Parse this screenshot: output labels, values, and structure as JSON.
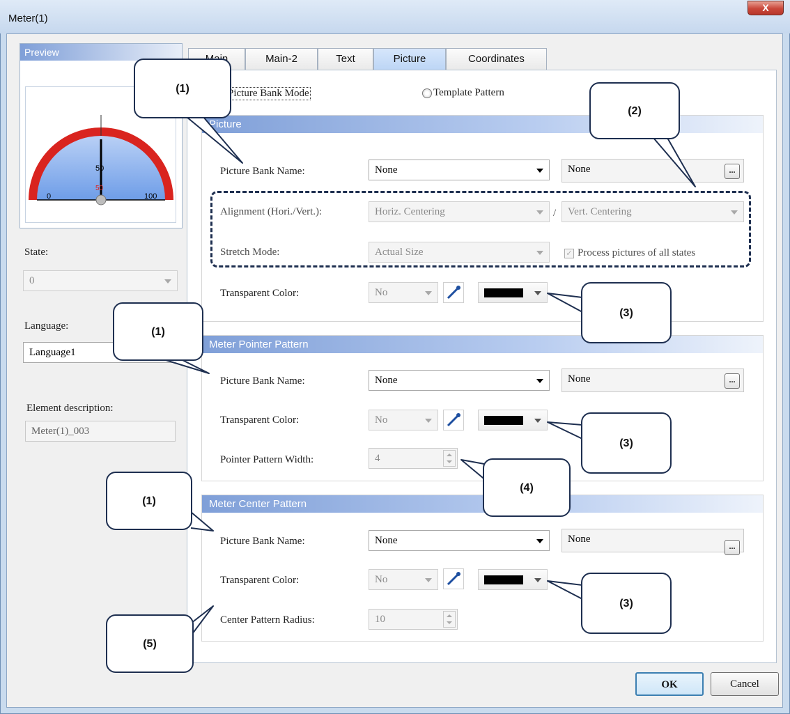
{
  "window": {
    "title": "Meter(1)",
    "close_glyph": "X"
  },
  "preview": {
    "header": "Preview",
    "gauge": {
      "label_top": "50",
      "label_red": "50",
      "label_min": "0",
      "label_max": "100"
    }
  },
  "left": {
    "state_label": "State:",
    "state_value": "0",
    "language_label": "Language:",
    "language_value": "Language1",
    "element_desc_label": "Element description:",
    "element_desc_value": "Meter(1)_003"
  },
  "tabs": [
    {
      "label": "Main"
    },
    {
      "label": "Main-2"
    },
    {
      "label": "Text"
    },
    {
      "label": "Picture",
      "active": true
    },
    {
      "label": "Coordinates"
    }
  ],
  "mode": {
    "picture_bank": "Picture Bank Mode",
    "template": "Template Pattern"
  },
  "picture_group": {
    "title": "Picture",
    "bank_name_label": "Picture Bank Name:",
    "bank_name_value": "None",
    "bank_name_text": "None",
    "alignment_label": "Alignment (Hori./Vert.):",
    "horiz_value": "Horiz. Centering",
    "separator": "/",
    "vert_value": "Vert. Centering",
    "stretch_label": "Stretch Mode:",
    "stretch_value": "Actual Size",
    "process_all_label": "Process pictures of all states",
    "transparent_label": "Transparent Color:",
    "transparent_value": "No"
  },
  "pointer_group": {
    "title": "Meter Pointer Pattern",
    "bank_name_label": "Picture Bank Name:",
    "bank_name_value": "None",
    "bank_name_text": "None",
    "transparent_label": "Transparent Color:",
    "transparent_value": "No",
    "width_label": "Pointer Pattern Width:",
    "width_value": "4"
  },
  "center_group": {
    "title": "Meter Center Pattern",
    "bank_name_label": "Picture Bank Name:",
    "bank_name_value": "None",
    "bank_name_text": "None",
    "transparent_label": "Transparent Color:",
    "transparent_value": "No",
    "radius_label": "Center Pattern Radius:",
    "radius_value": "10"
  },
  "ellipsis": "...",
  "callouts": {
    "c1a": "(1)",
    "c1b": "(1)",
    "c1c": "(1)",
    "c2": "(2)",
    "c3a": "(3)",
    "c3b": "(3)",
    "c3c": "(3)",
    "c4": "(4)",
    "c5": "(5)"
  },
  "buttons": {
    "ok": "OK",
    "cancel": "Cancel"
  },
  "colors": {
    "accent": "#7f9fd8",
    "callout_border": "#1e2f50",
    "gauge_red": "#e0201c",
    "gauge_blue": "#6e9de8"
  }
}
